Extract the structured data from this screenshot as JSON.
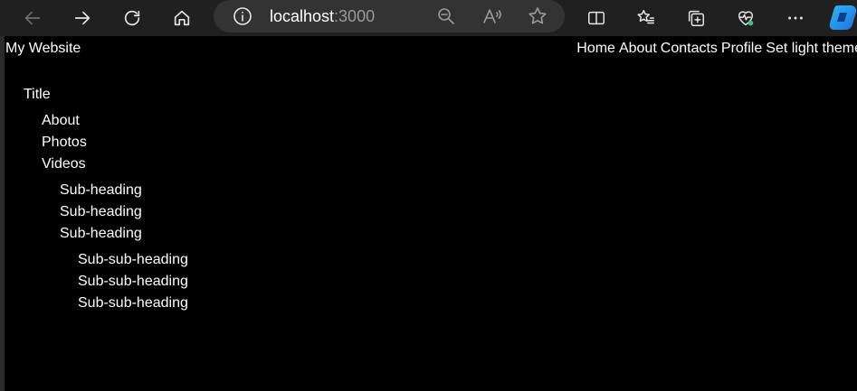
{
  "browser": {
    "url_host": "localhost",
    "url_port": ":3000"
  },
  "site": {
    "title": "My Website",
    "nav": [
      "Home",
      "About",
      "Contacts",
      "Profile",
      "Set light theme"
    ]
  },
  "content": {
    "heading": "Title",
    "level1": [
      "About",
      "Photos",
      "Videos"
    ],
    "level2": [
      "Sub-heading",
      "Sub-heading",
      "Sub-heading"
    ],
    "level3": [
      "Sub-sub-heading",
      "Sub-sub-heading",
      "Sub-sub-heading"
    ]
  }
}
